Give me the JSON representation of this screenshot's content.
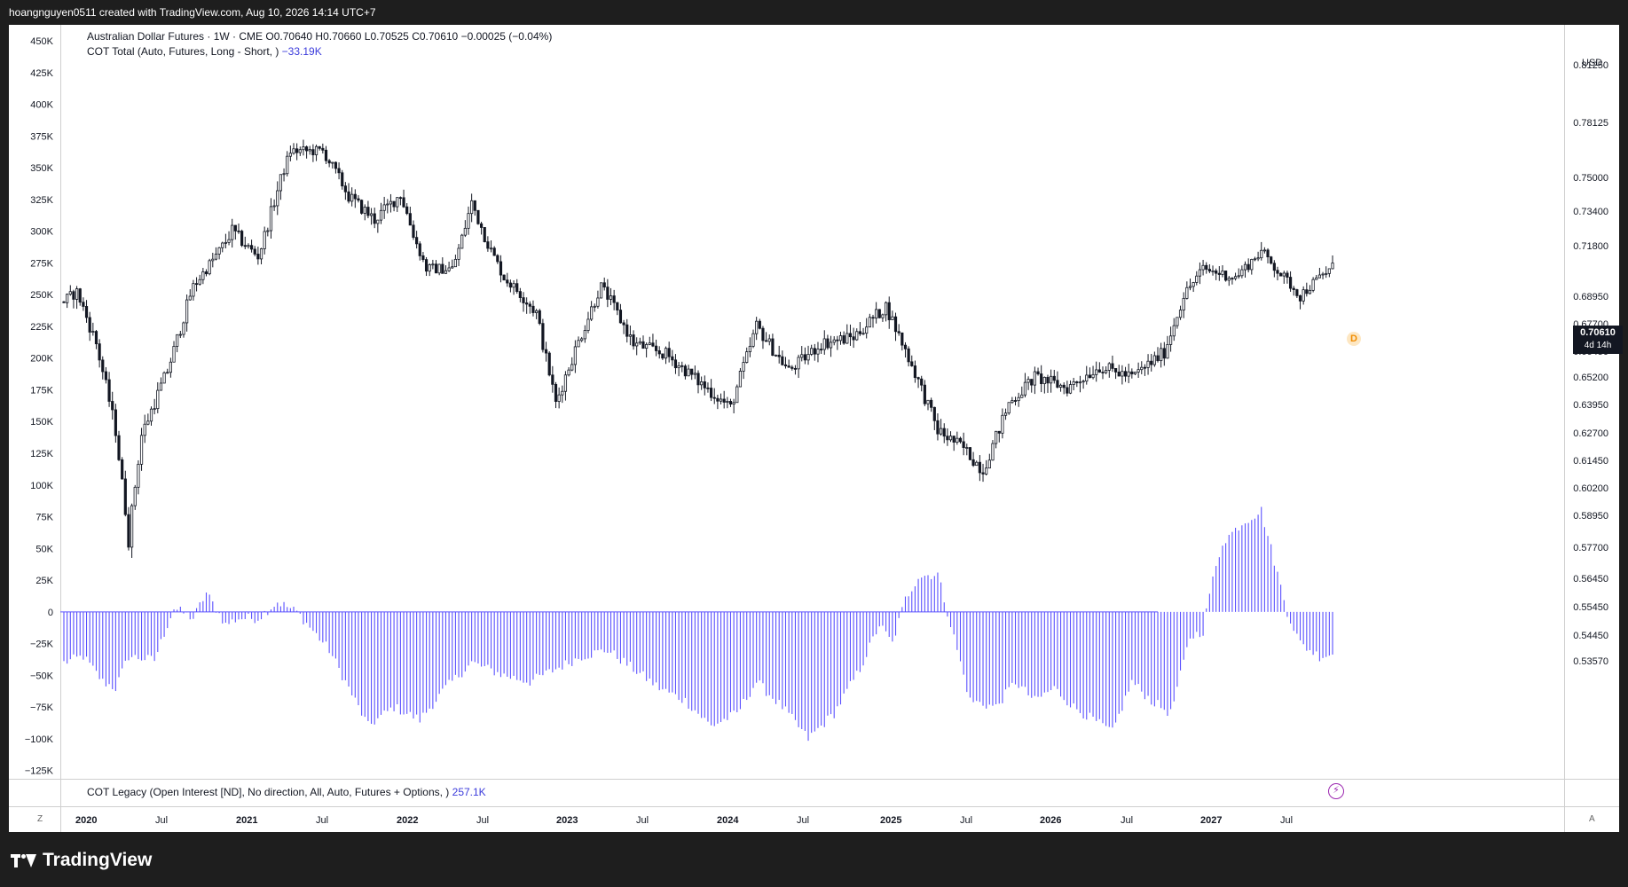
{
  "header": {
    "watermark": "hoangnguyen0511 created with TradingView.com, Aug 10, 2026 14:14 UTC+7"
  },
  "legend": {
    "line1": "Australian Dollar Futures · 1W · CME  O0.70640  H0.70660  L0.70525  C0.70610  −0.00025 (−0.04%)",
    "line2_label": "COT Total (Auto, Futures, Long - Short, )",
    "line2_value": "−33.19K",
    "line3_label": "COT Legacy (Open Interest [ND], No direction, All, Auto, Futures + Options, )",
    "line3_value": "257.1K"
  },
  "currency": "USD",
  "last_price": {
    "value": "0.70610",
    "countdown": "4d 14h"
  },
  "markers": {
    "dividend": "D",
    "flash": "⚡"
  },
  "corners": {
    "left": "Z",
    "right": "A"
  },
  "brand": {
    "name": "TradingView"
  },
  "colors": {
    "candle": "#131722",
    "cot_bars": "#5a50ff",
    "background": "#ffffff",
    "frame": "#1e1e1e"
  },
  "chart_data": {
    "type": "candlestick",
    "x_tick_labels": [
      "2020",
      "Jul",
      "2021",
      "Jul",
      "2022",
      "Jul",
      "2023",
      "Jul",
      "2024",
      "Jul",
      "2025",
      "Jul",
      "2026",
      "Jul",
      "2027",
      "Jul"
    ],
    "left_axis_labels": [
      "450K",
      "425K",
      "400K",
      "375K",
      "350K",
      "325K",
      "300K",
      "275K",
      "250K",
      "225K",
      "200K",
      "175K",
      "150K",
      "125K",
      "100K",
      "75K",
      "50K",
      "25K",
      "0",
      "−25K",
      "−50K",
      "−75K",
      "−100K",
      "−125K"
    ],
    "right_axis_labels": [
      "0.81250",
      "0.78125",
      "0.75000",
      "0.73400",
      "0.71800",
      "0.68950",
      "0.67700",
      "0.66450",
      "0.65200",
      "0.63950",
      "0.62700",
      "0.61450",
      "0.60200",
      "0.58950",
      "0.57700",
      "0.56450",
      "0.55450",
      "0.54450",
      "0.53570"
    ],
    "price_anchors": [
      {
        "t": 0,
        "v": 0.687
      },
      {
        "t": 4,
        "v": 0.692
      },
      {
        "t": 10,
        "v": 0.668
      },
      {
        "t": 16,
        "v": 0.628
      },
      {
        "t": 20,
        "v": 0.58
      },
      {
        "t": 24,
        "v": 0.626
      },
      {
        "t": 32,
        "v": 0.655
      },
      {
        "t": 40,
        "v": 0.695
      },
      {
        "t": 52,
        "v": 0.725
      },
      {
        "t": 60,
        "v": 0.712
      },
      {
        "t": 70,
        "v": 0.765
      },
      {
        "t": 80,
        "v": 0.765
      },
      {
        "t": 88,
        "v": 0.741
      },
      {
        "t": 96,
        "v": 0.73
      },
      {
        "t": 104,
        "v": 0.742
      },
      {
        "t": 112,
        "v": 0.705
      },
      {
        "t": 120,
        "v": 0.705
      },
      {
        "t": 126,
        "v": 0.738
      },
      {
        "t": 136,
        "v": 0.7
      },
      {
        "t": 146,
        "v": 0.682
      },
      {
        "t": 152,
        "v": 0.64
      },
      {
        "t": 158,
        "v": 0.665
      },
      {
        "t": 166,
        "v": 0.695
      },
      {
        "t": 176,
        "v": 0.668
      },
      {
        "t": 186,
        "v": 0.663
      },
      {
        "t": 196,
        "v": 0.65
      },
      {
        "t": 206,
        "v": 0.638
      },
      {
        "t": 214,
        "v": 0.676
      },
      {
        "t": 224,
        "v": 0.655
      },
      {
        "t": 234,
        "v": 0.668
      },
      {
        "t": 244,
        "v": 0.671
      },
      {
        "t": 254,
        "v": 0.685
      },
      {
        "t": 260,
        "v": 0.665
      },
      {
        "t": 270,
        "v": 0.628
      },
      {
        "t": 278,
        "v": 0.62
      },
      {
        "t": 284,
        "v": 0.61
      },
      {
        "t": 292,
        "v": 0.64
      },
      {
        "t": 300,
        "v": 0.652
      },
      {
        "t": 310,
        "v": 0.647
      },
      {
        "t": 320,
        "v": 0.657
      },
      {
        "t": 330,
        "v": 0.652
      },
      {
        "t": 340,
        "v": 0.664
      },
      {
        "t": 346,
        "v": 0.69
      },
      {
        "t": 352,
        "v": 0.705
      },
      {
        "t": 362,
        "v": 0.7
      },
      {
        "t": 370,
        "v": 0.715
      },
      {
        "t": 376,
        "v": 0.702
      },
      {
        "t": 382,
        "v": 0.69
      },
      {
        "t": 388,
        "v": 0.7
      },
      {
        "t": 392,
        "v": 0.706
      }
    ],
    "cot_anchors": [
      {
        "t": 0,
        "v": -40
      },
      {
        "t": 6,
        "v": -35
      },
      {
        "t": 12,
        "v": -55
      },
      {
        "t": 16,
        "v": -60
      },
      {
        "t": 20,
        "v": -35
      },
      {
        "t": 28,
        "v": -38
      },
      {
        "t": 32,
        "v": -10
      },
      {
        "t": 34,
        "v": 3
      },
      {
        "t": 40,
        "v": -5
      },
      {
        "t": 44,
        "v": 15
      },
      {
        "t": 50,
        "v": -10
      },
      {
        "t": 54,
        "v": -5
      },
      {
        "t": 60,
        "v": -5
      },
      {
        "t": 66,
        "v": 8
      },
      {
        "t": 72,
        "v": 0
      },
      {
        "t": 82,
        "v": -30
      },
      {
        "t": 88,
        "v": -60
      },
      {
        "t": 94,
        "v": -90
      },
      {
        "t": 102,
        "v": -75
      },
      {
        "t": 110,
        "v": -85
      },
      {
        "t": 118,
        "v": -60
      },
      {
        "t": 126,
        "v": -40
      },
      {
        "t": 136,
        "v": -50
      },
      {
        "t": 144,
        "v": -55
      },
      {
        "t": 152,
        "v": -45
      },
      {
        "t": 160,
        "v": -35
      },
      {
        "t": 168,
        "v": -30
      },
      {
        "t": 176,
        "v": -45
      },
      {
        "t": 184,
        "v": -60
      },
      {
        "t": 192,
        "v": -70
      },
      {
        "t": 200,
        "v": -90
      },
      {
        "t": 208,
        "v": -80
      },
      {
        "t": 214,
        "v": -55
      },
      {
        "t": 222,
        "v": -75
      },
      {
        "t": 230,
        "v": -100
      },
      {
        "t": 238,
        "v": -80
      },
      {
        "t": 246,
        "v": -45
      },
      {
        "t": 252,
        "v": -10
      },
      {
        "t": 256,
        "v": -25
      },
      {
        "t": 260,
        "v": 10
      },
      {
        "t": 264,
        "v": 28
      },
      {
        "t": 270,
        "v": 30
      },
      {
        "t": 274,
        "v": -10
      },
      {
        "t": 280,
        "v": -70
      },
      {
        "t": 288,
        "v": -75
      },
      {
        "t": 294,
        "v": -55
      },
      {
        "t": 300,
        "v": -70
      },
      {
        "t": 306,
        "v": -60
      },
      {
        "t": 312,
        "v": -75
      },
      {
        "t": 318,
        "v": -85
      },
      {
        "t": 324,
        "v": -95
      },
      {
        "t": 330,
        "v": -55
      },
      {
        "t": 336,
        "v": -70
      },
      {
        "t": 342,
        "v": -80
      },
      {
        "t": 348,
        "v": -20
      },
      {
        "t": 352,
        "v": -15
      },
      {
        "t": 354,
        "v": 15
      },
      {
        "t": 358,
        "v": 55
      },
      {
        "t": 364,
        "v": 70
      },
      {
        "t": 370,
        "v": 80
      },
      {
        "t": 374,
        "v": 40
      },
      {
        "t": 378,
        "v": 0
      },
      {
        "t": 382,
        "v": -25
      },
      {
        "t": 388,
        "v": -35
      },
      {
        "t": 392,
        "v": -33
      }
    ],
    "weeks": 393,
    "ylim_left": [
      -125,
      450
    ]
  }
}
